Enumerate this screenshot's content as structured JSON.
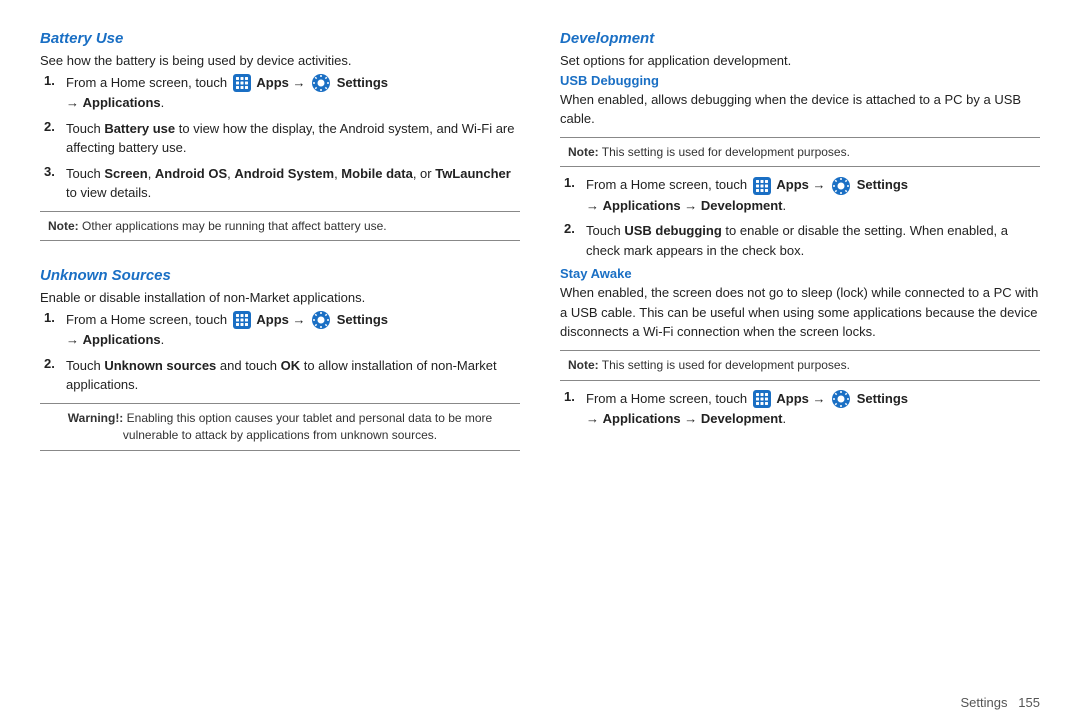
{
  "left": {
    "battery_use": {
      "title": "Battery Use",
      "intro": "See how the battery is being used by device activities.",
      "steps": [
        {
          "num": "1.",
          "prefix": "From a Home screen, touch",
          "apps": "Apps",
          "arrow1": "→",
          "settings": "Settings",
          "arrow2": "→",
          "bold_text": "Applications",
          "suffix": "."
        },
        {
          "num": "2.",
          "text_parts": [
            {
              "text": "Touch ",
              "bold": false
            },
            {
              "text": "Battery use",
              "bold": true
            },
            {
              "text": " to view how the display, the Android system, and Wi-Fi are affecting battery use.",
              "bold": false
            }
          ]
        },
        {
          "num": "3.",
          "text_parts": [
            {
              "text": "Touch ",
              "bold": false
            },
            {
              "text": "Screen",
              "bold": true
            },
            {
              "text": ", ",
              "bold": false
            },
            {
              "text": "Android OS",
              "bold": true
            },
            {
              "text": ", ",
              "bold": false
            },
            {
              "text": "Android System",
              "bold": true
            },
            {
              "text": ", ",
              "bold": false
            },
            {
              "text": "Mobile data",
              "bold": true
            },
            {
              "text": ", or ",
              "bold": false
            },
            {
              "text": "TwLauncher",
              "bold": true
            },
            {
              "text": " to view details.",
              "bold": false
            }
          ]
        }
      ],
      "note": {
        "label": "Note:",
        "text": " Other applications may be running that affect battery use."
      }
    },
    "unknown_sources": {
      "title": "Unknown Sources",
      "intro": "Enable or disable installation of non-Market applications.",
      "steps": [
        {
          "num": "1.",
          "prefix": "From a Home screen, touch",
          "apps": "Apps",
          "arrow1": "→",
          "settings": "Settings",
          "arrow2": "→",
          "bold_text": "Applications",
          "suffix": "."
        },
        {
          "num": "2.",
          "text_parts": [
            {
              "text": "Touch ",
              "bold": false
            },
            {
              "text": "Unknown sources",
              "bold": true
            },
            {
              "text": " and touch ",
              "bold": false
            },
            {
              "text": "OK",
              "bold": true
            },
            {
              "text": " to allow installation of non-Market applications.",
              "bold": false
            }
          ]
        }
      ],
      "warning": {
        "label": "Warning!:",
        "text": " Enabling this option causes your tablet and personal data to be more vulnerable to attack by applications from unknown sources."
      }
    }
  },
  "right": {
    "development": {
      "title": "Development",
      "intro": "Set options for application development.",
      "usb_debugging": {
        "subtitle": "USB Debugging",
        "body": "When enabled, allows debugging when the device is attached to a PC by a USB cable.",
        "note": {
          "label": "Note:",
          "text": " This setting is used for development purposes."
        },
        "steps": [
          {
            "num": "1.",
            "prefix": "From a Home screen, touch",
            "apps": "Apps",
            "arrow1": "→",
            "settings": "Settings",
            "arrow2": "→",
            "bold_text": "Applications",
            "arrow3": "→",
            "bold_text2": "Development",
            "suffix": "."
          },
          {
            "num": "2.",
            "text_parts": [
              {
                "text": "Touch ",
                "bold": false
              },
              {
                "text": "USB debugging",
                "bold": true
              },
              {
                "text": " to enable or disable the setting. When enabled, a check mark appears in the check box.",
                "bold": false
              }
            ]
          }
        ]
      },
      "stay_awake": {
        "subtitle": "Stay Awake",
        "body": "When enabled, the screen does not go to sleep (lock) while connected to a PC with a USB cable. This can be useful when using some applications because the device disconnects a Wi-Fi connection when the screen locks.",
        "note": {
          "label": "Note:",
          "text": " This setting is used for development purposes."
        },
        "steps": [
          {
            "num": "1.",
            "prefix": "From a Home screen, touch",
            "apps": "Apps",
            "arrow1": "→",
            "settings": "Settings",
            "arrow2": "→",
            "bold_text": "Applications",
            "arrow3": "→",
            "bold_text2": "Development",
            "suffix": "."
          }
        ]
      }
    }
  },
  "footer": {
    "label": "Settings",
    "page": "155"
  }
}
